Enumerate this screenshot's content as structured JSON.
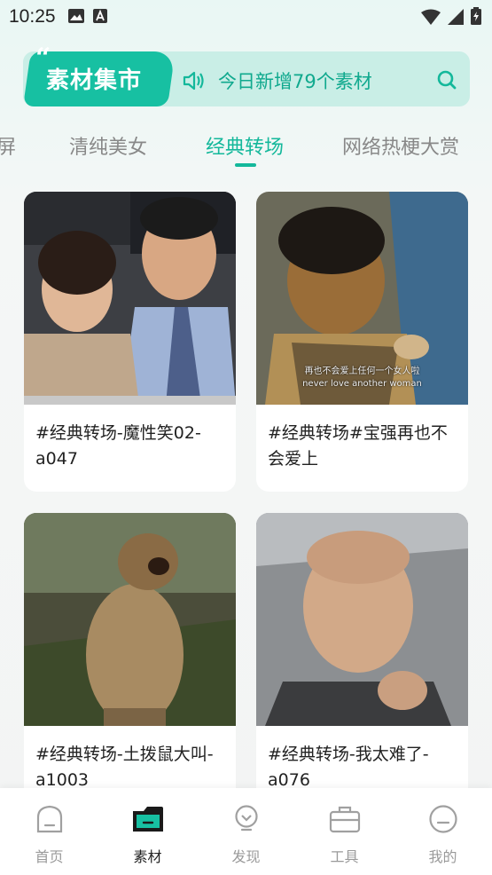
{
  "status_bar": {
    "time": "10:25"
  },
  "banner": {
    "tag_label": "素材集市",
    "announcement": "今日新增79个素材"
  },
  "tabs": [
    {
      "label": "屏"
    },
    {
      "label": "清纯美女"
    },
    {
      "label": "经典转场"
    },
    {
      "label": "网络热梗大赏"
    }
  ],
  "cards": [
    {
      "caption": "#经典转场-魔性笑02-a047"
    },
    {
      "caption": "#经典转场#宝强再也不会爱上"
    },
    {
      "caption": "#经典转场-土拨鼠大叫-a1003"
    },
    {
      "caption": "#经典转场-我太难了-a076"
    }
  ],
  "card_subtitle": {
    "line1": "再也不会爱上任何一个女人啦",
    "line2": "never love another woman"
  },
  "bottom_nav": [
    {
      "label": "首页"
    },
    {
      "label": "素材"
    },
    {
      "label": "发现"
    },
    {
      "label": "工具"
    },
    {
      "label": "我的"
    }
  ],
  "colors": {
    "accent": "#14b89b",
    "banner_bg": "#c9eee6"
  }
}
